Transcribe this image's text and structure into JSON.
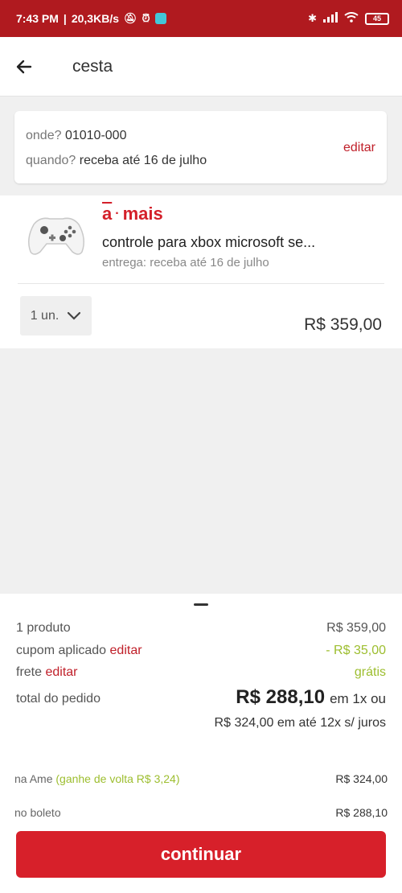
{
  "statusbar": {
    "time": "7:43 PM",
    "speed": "20,3KB/s",
    "battery": "45",
    "icons": [
      "mute-icon",
      "alarm-icon",
      "app-icon",
      "bluetooth-icon",
      "signal-icon",
      "wifi-icon",
      "battery-icon"
    ]
  },
  "header": {
    "title": "cesta"
  },
  "address": {
    "where_label": "onde?",
    "where_value": "01010-000",
    "when_label": "quando?",
    "when_value": "receba até 16 de julho",
    "edit_label": "editar"
  },
  "product": {
    "brand_a": "a",
    "brand_rest": "mais",
    "name": "controle para xbox microsoft se...",
    "delivery": "entrega: receba até 16 de julho",
    "qty": "1 un.",
    "price": "R$ 359,00"
  },
  "summary": {
    "products_label": "1 produto",
    "products_value": "R$ 359,00",
    "coupon_label": "cupom aplicado",
    "coupon_edit": "editar",
    "coupon_value": "- R$ 35,00",
    "shipping_label": "frete",
    "shipping_edit": "editar",
    "shipping_value": "grátis",
    "total_label": "total do pedido",
    "total_value": "R$ 288,10",
    "total_suffix": "em 1x ou",
    "installments": "R$ 324,00 em até 12x s/ juros",
    "ame_label": "na Ame",
    "ame_bonus": "(ganhe de volta R$ 3,24)",
    "ame_value": "R$ 324,00",
    "boleto_label": "no boleto",
    "boleto_value": "R$ 288,10",
    "continue_label": "continuar"
  },
  "colors": {
    "brand_red": "#d7202a",
    "status_bar": "#b01a1f",
    "discount_green": "#9dbe2f"
  }
}
